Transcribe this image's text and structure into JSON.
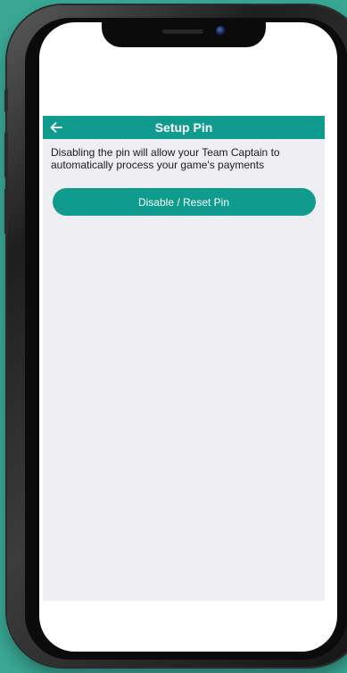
{
  "header": {
    "title": "Setup Pin",
    "back_icon": "arrow-left-icon"
  },
  "content": {
    "description": "Disabling the pin will allow your Team Captain to automatically process your game's payments",
    "button_label": "Disable / Reset Pin"
  },
  "colors": {
    "accent": "#0f9c8e",
    "page_background": "#efeef3",
    "outer_background": "#3aa895"
  }
}
